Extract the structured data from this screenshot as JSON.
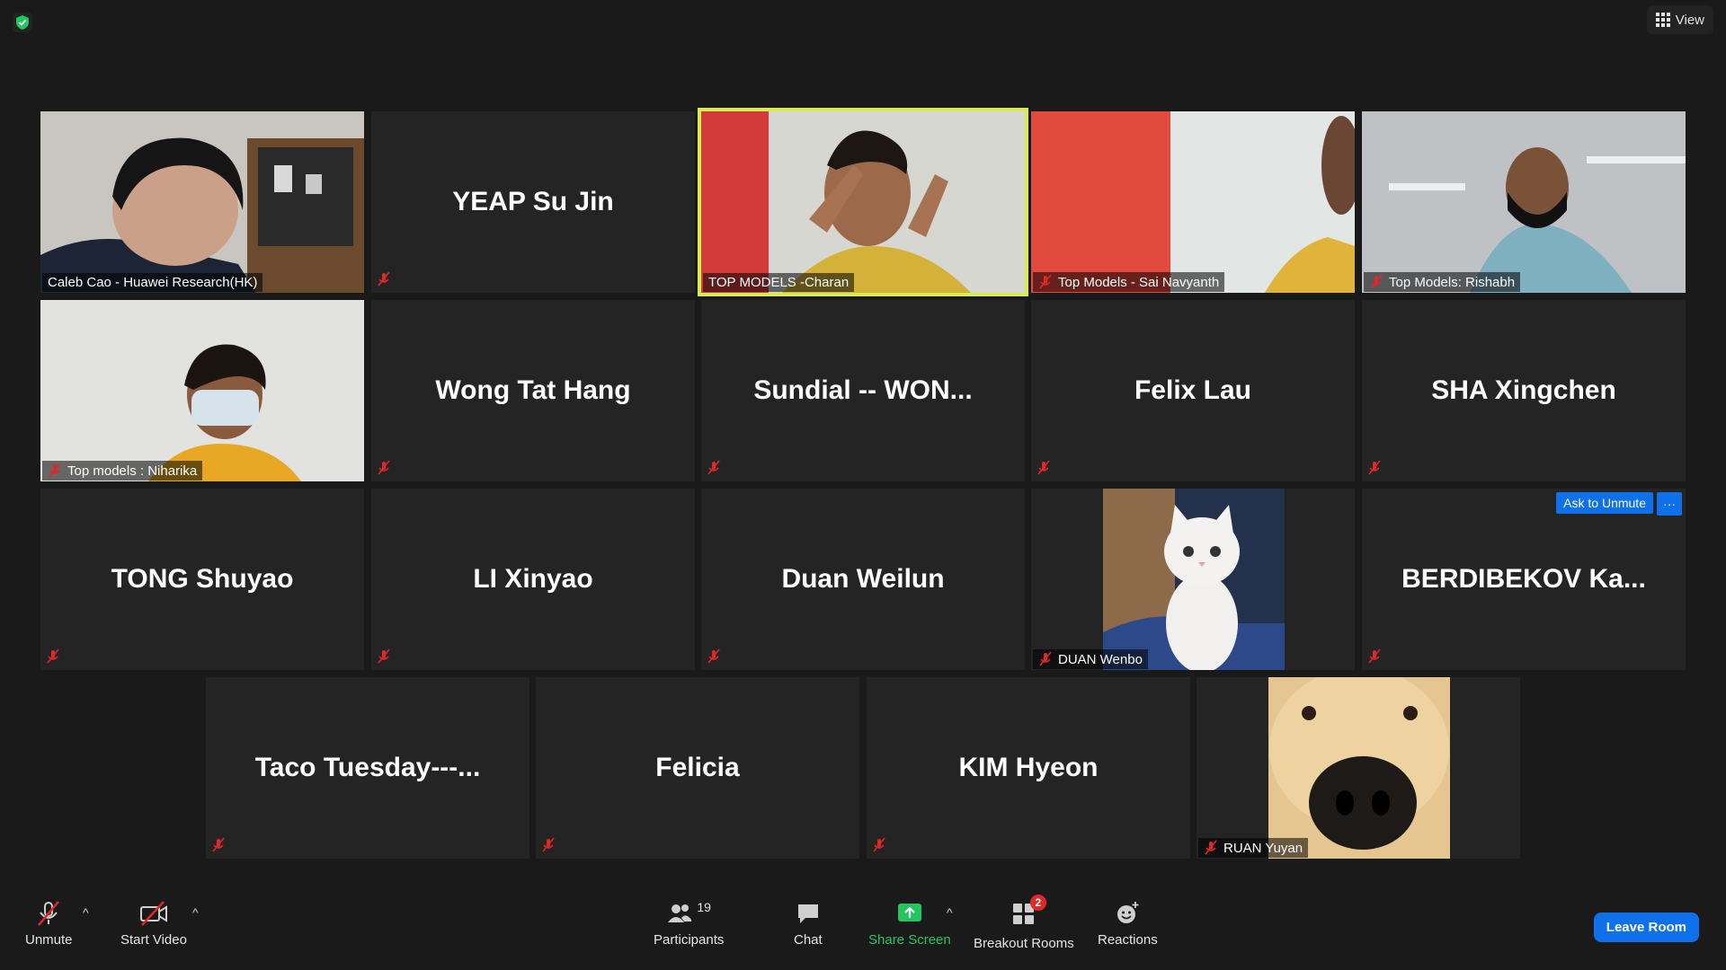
{
  "top_right": {
    "view_label": "View"
  },
  "tiles": [
    {
      "name": "Caleb Cao - Huawei Research(HK)"
    },
    {
      "name": "YEAP Su Jin"
    },
    {
      "name": "TOP MODELS -Charan"
    },
    {
      "name": "Top Models - Sai Navyanth"
    },
    {
      "name": "Top Models: Rishabh"
    },
    {
      "name": "Top models : Niharika"
    },
    {
      "name": "Wong Tat Hang"
    },
    {
      "name": "Sundial  --  WON..."
    },
    {
      "name": "Felix Lau"
    },
    {
      "name": "SHA Xingchen"
    },
    {
      "name": "TONG Shuyao"
    },
    {
      "name": "LI Xinyao"
    },
    {
      "name": "Duan Weilun"
    },
    {
      "name": "DUAN Wenbo"
    },
    {
      "name": "BERDIBEKOV  Ka..."
    },
    {
      "name": "Taco  Tuesday---..."
    },
    {
      "name": "Felicia"
    },
    {
      "name": "KIM Hyeon"
    },
    {
      "name": "RUAN Yuyan"
    }
  ],
  "tile_actions": {
    "ask_to_unmute": "Ask to Unmute",
    "more": "···"
  },
  "toolbar": {
    "unmute": "Unmute",
    "start_video": "Start Video",
    "participants": "Participants",
    "participants_count": "19",
    "chat": "Chat",
    "share_screen": "Share Screen",
    "breakout_rooms": "Breakout Rooms",
    "breakout_badge": "2",
    "reactions": "Reactions",
    "leave_room": "Leave Room"
  },
  "colors": {
    "accent": "#0e71eb",
    "active_speaker": "#d8ea55",
    "share_green": "#23c55e",
    "mute_red": "#e02828"
  }
}
